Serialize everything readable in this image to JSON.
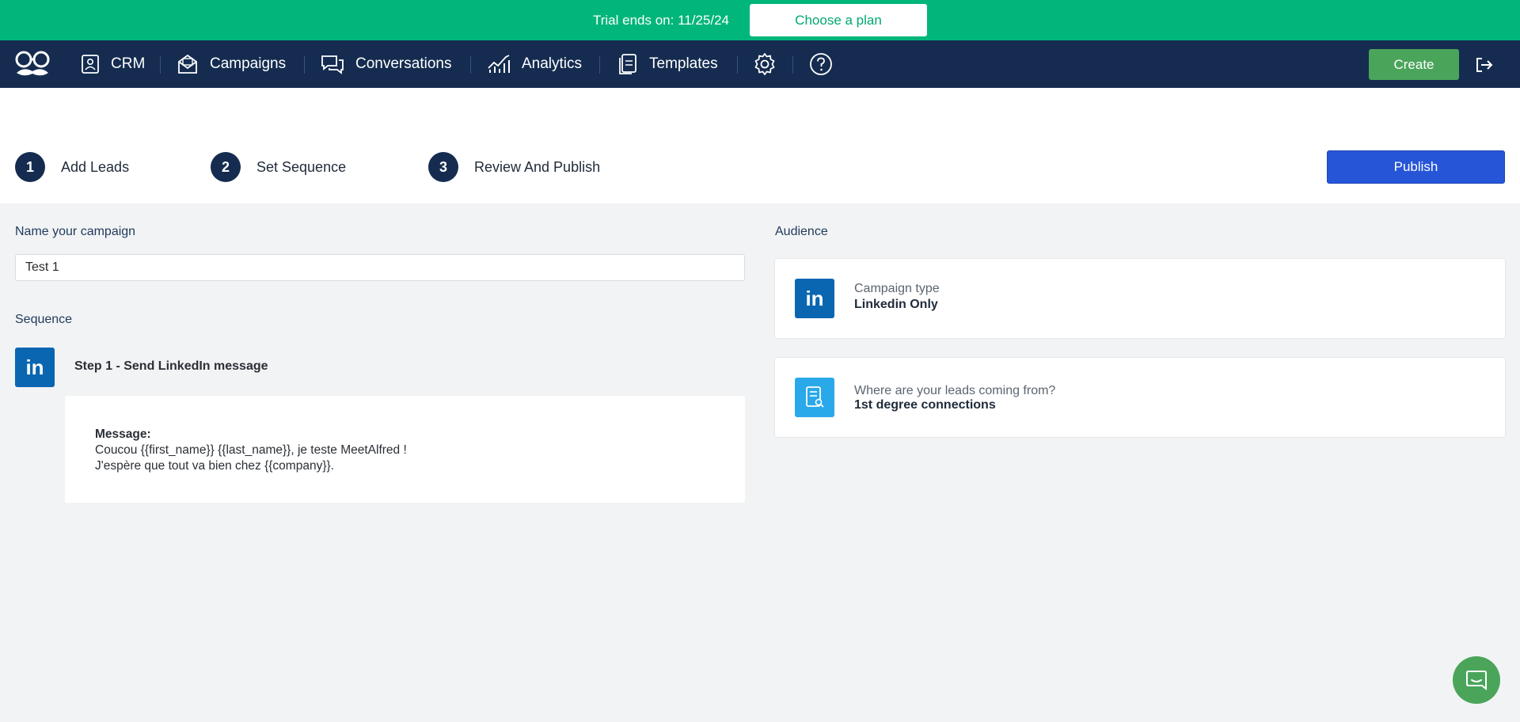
{
  "trial": {
    "text": "Trial ends on: 11/25/24",
    "button": "Choose a plan"
  },
  "nav": {
    "items": [
      {
        "label": "CRM",
        "icon": "crm-icon"
      },
      {
        "label": "Campaigns",
        "icon": "campaigns-icon"
      },
      {
        "label": "Conversations",
        "icon": "conversations-icon"
      },
      {
        "label": "Analytics",
        "icon": "analytics-icon"
      },
      {
        "label": "Templates",
        "icon": "templates-icon"
      }
    ],
    "create_label": "Create"
  },
  "stepper": {
    "steps": [
      {
        "num": "1",
        "label": "Add Leads"
      },
      {
        "num": "2",
        "label": "Set Sequence"
      },
      {
        "num": "3",
        "label": "Review And Publish"
      }
    ],
    "publish_label": "Publish"
  },
  "form": {
    "name_label": "Name your campaign",
    "name_value": "Test 1",
    "sequence_label": "Sequence",
    "linkedin_badge": "in",
    "step_title": "Step 1 - Send LinkedIn message",
    "message_title": "Message:",
    "message_line1": "Coucou {{first_name}} {{last_name}}, je teste MeetAlfred !",
    "message_line2": "J'espère que tout va bien chez {{company}}."
  },
  "audience": {
    "label": "Audience",
    "type_sub": "Campaign type",
    "type_main": "Linkedin Only",
    "leads_sub": "Where are your leads coming from?",
    "leads_main": "1st degree connections"
  },
  "colors": {
    "trial_green": "#00b67a",
    "nav_navy": "#152c50",
    "create_green": "#4aa55b",
    "publish_blue": "#2755d8",
    "linkedin_blue": "#0a66b0",
    "leads_icon_blue": "#29a9ea"
  }
}
